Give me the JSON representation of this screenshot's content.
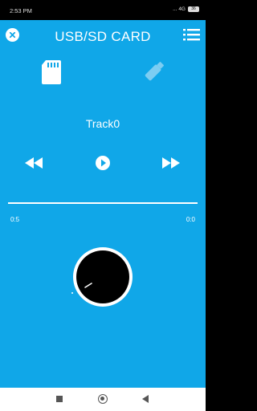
{
  "status_bar": {
    "time": "2:53 PM",
    "indicators": "... 4G",
    "battery": "36"
  },
  "header": {
    "title": "USB/SD CARD",
    "close_icon": "close-icon",
    "menu_icon": "list-menu-icon"
  },
  "sources": {
    "sd_icon": "sd-card-icon",
    "usb_icon": "usb-drive-icon",
    "active": "sd"
  },
  "player": {
    "track_name": "Track0",
    "current_time": "0:5",
    "duration": "0:0",
    "controls": [
      "previous-icon",
      "play-icon",
      "next-icon"
    ]
  },
  "colors": {
    "background": "#10A7E8",
    "foreground": "#FFFFFF",
    "knob": "#000000"
  }
}
